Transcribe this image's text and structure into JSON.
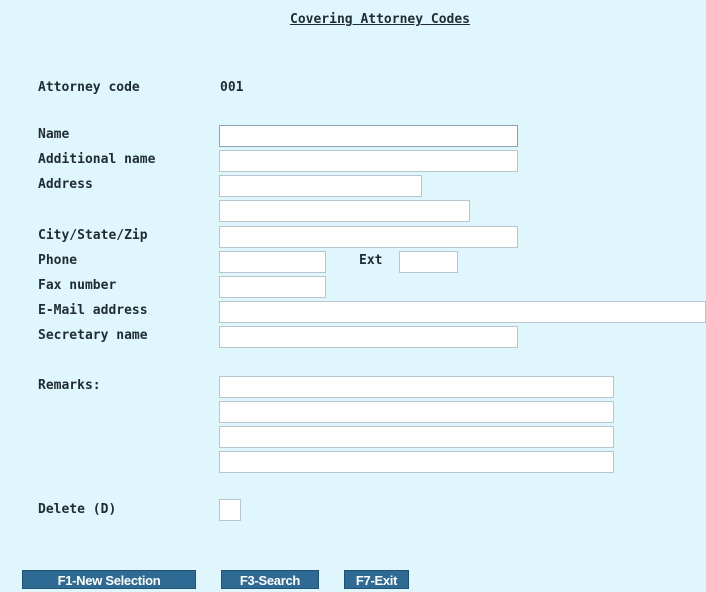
{
  "screen": {
    "title": "Covering Attorney Codes"
  },
  "form": {
    "attorney_code_label": "Attorney code",
    "attorney_code_value": "001",
    "name_label": "Name",
    "name_value": "",
    "additional_name_label": "Additional name",
    "additional_name_value": "",
    "address_label": "Address",
    "address_line1_value": "",
    "address_line2_value": "",
    "city_state_zip_label": "City/State/Zip",
    "city_state_zip_value": "",
    "phone_label": "Phone",
    "phone_value": "",
    "ext_label": "Ext",
    "ext_value": "",
    "fax_label": "Fax number",
    "fax_value": "",
    "email_label": "E-Mail address",
    "email_value": "",
    "secretary_label": "Secretary name",
    "secretary_value": "",
    "remarks_label": "Remarks:",
    "remarks_lines": [
      "",
      "",
      "",
      ""
    ],
    "delete_label": "Delete (D)",
    "delete_value": ""
  },
  "function_keys": {
    "f1": "F1-New Selection",
    "f3": "F3-Search",
    "f7": "F7-Exit"
  },
  "colors": {
    "background": "#e0f6fd",
    "button": "#2e6a93",
    "field": "#ffffff"
  }
}
